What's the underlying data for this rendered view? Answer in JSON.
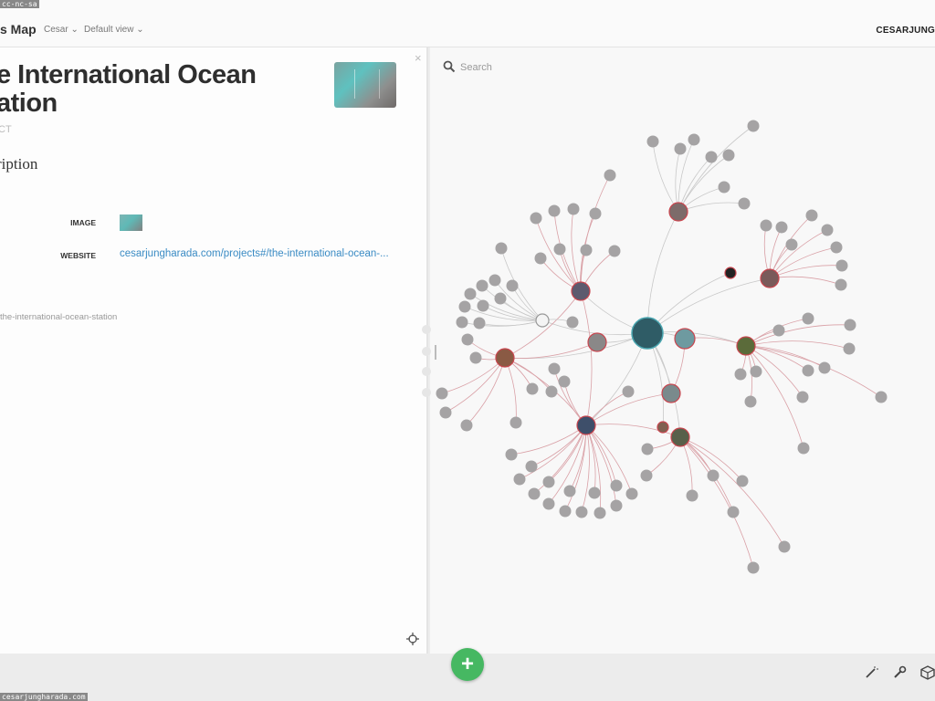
{
  "license_tag": "cc-nc-sa",
  "footer_tag": "cesarjungharada.com",
  "header": {
    "app_title": "s Map",
    "menu_user": "Cesar",
    "menu_view": "Default view",
    "username": "CESARJUNG"
  },
  "detail": {
    "title": "e International Ocean ation",
    "type": "CT",
    "section_heading": "ription",
    "fields": {
      "image_label": "IMAGE",
      "website_label": "WEBSITE",
      "website_value": "cesarjungharada.com/projects#/the-international-ocean-..."
    },
    "tag": "the-international-ocean-station"
  },
  "map": {
    "search_placeholder": "Search"
  },
  "colors": {
    "accent_add": "#46b862",
    "link": "#3a8bc4",
    "node_gray": "#a5a3a4",
    "edge_red": "#d9a0a6",
    "edge_gray": "#c8c8c8"
  },
  "icons": [
    "search-icon",
    "close-icon",
    "locate-icon",
    "plus-icon",
    "magic-wand-icon",
    "wrench-icon",
    "cube-icon",
    "chevron-down-icon"
  ]
}
